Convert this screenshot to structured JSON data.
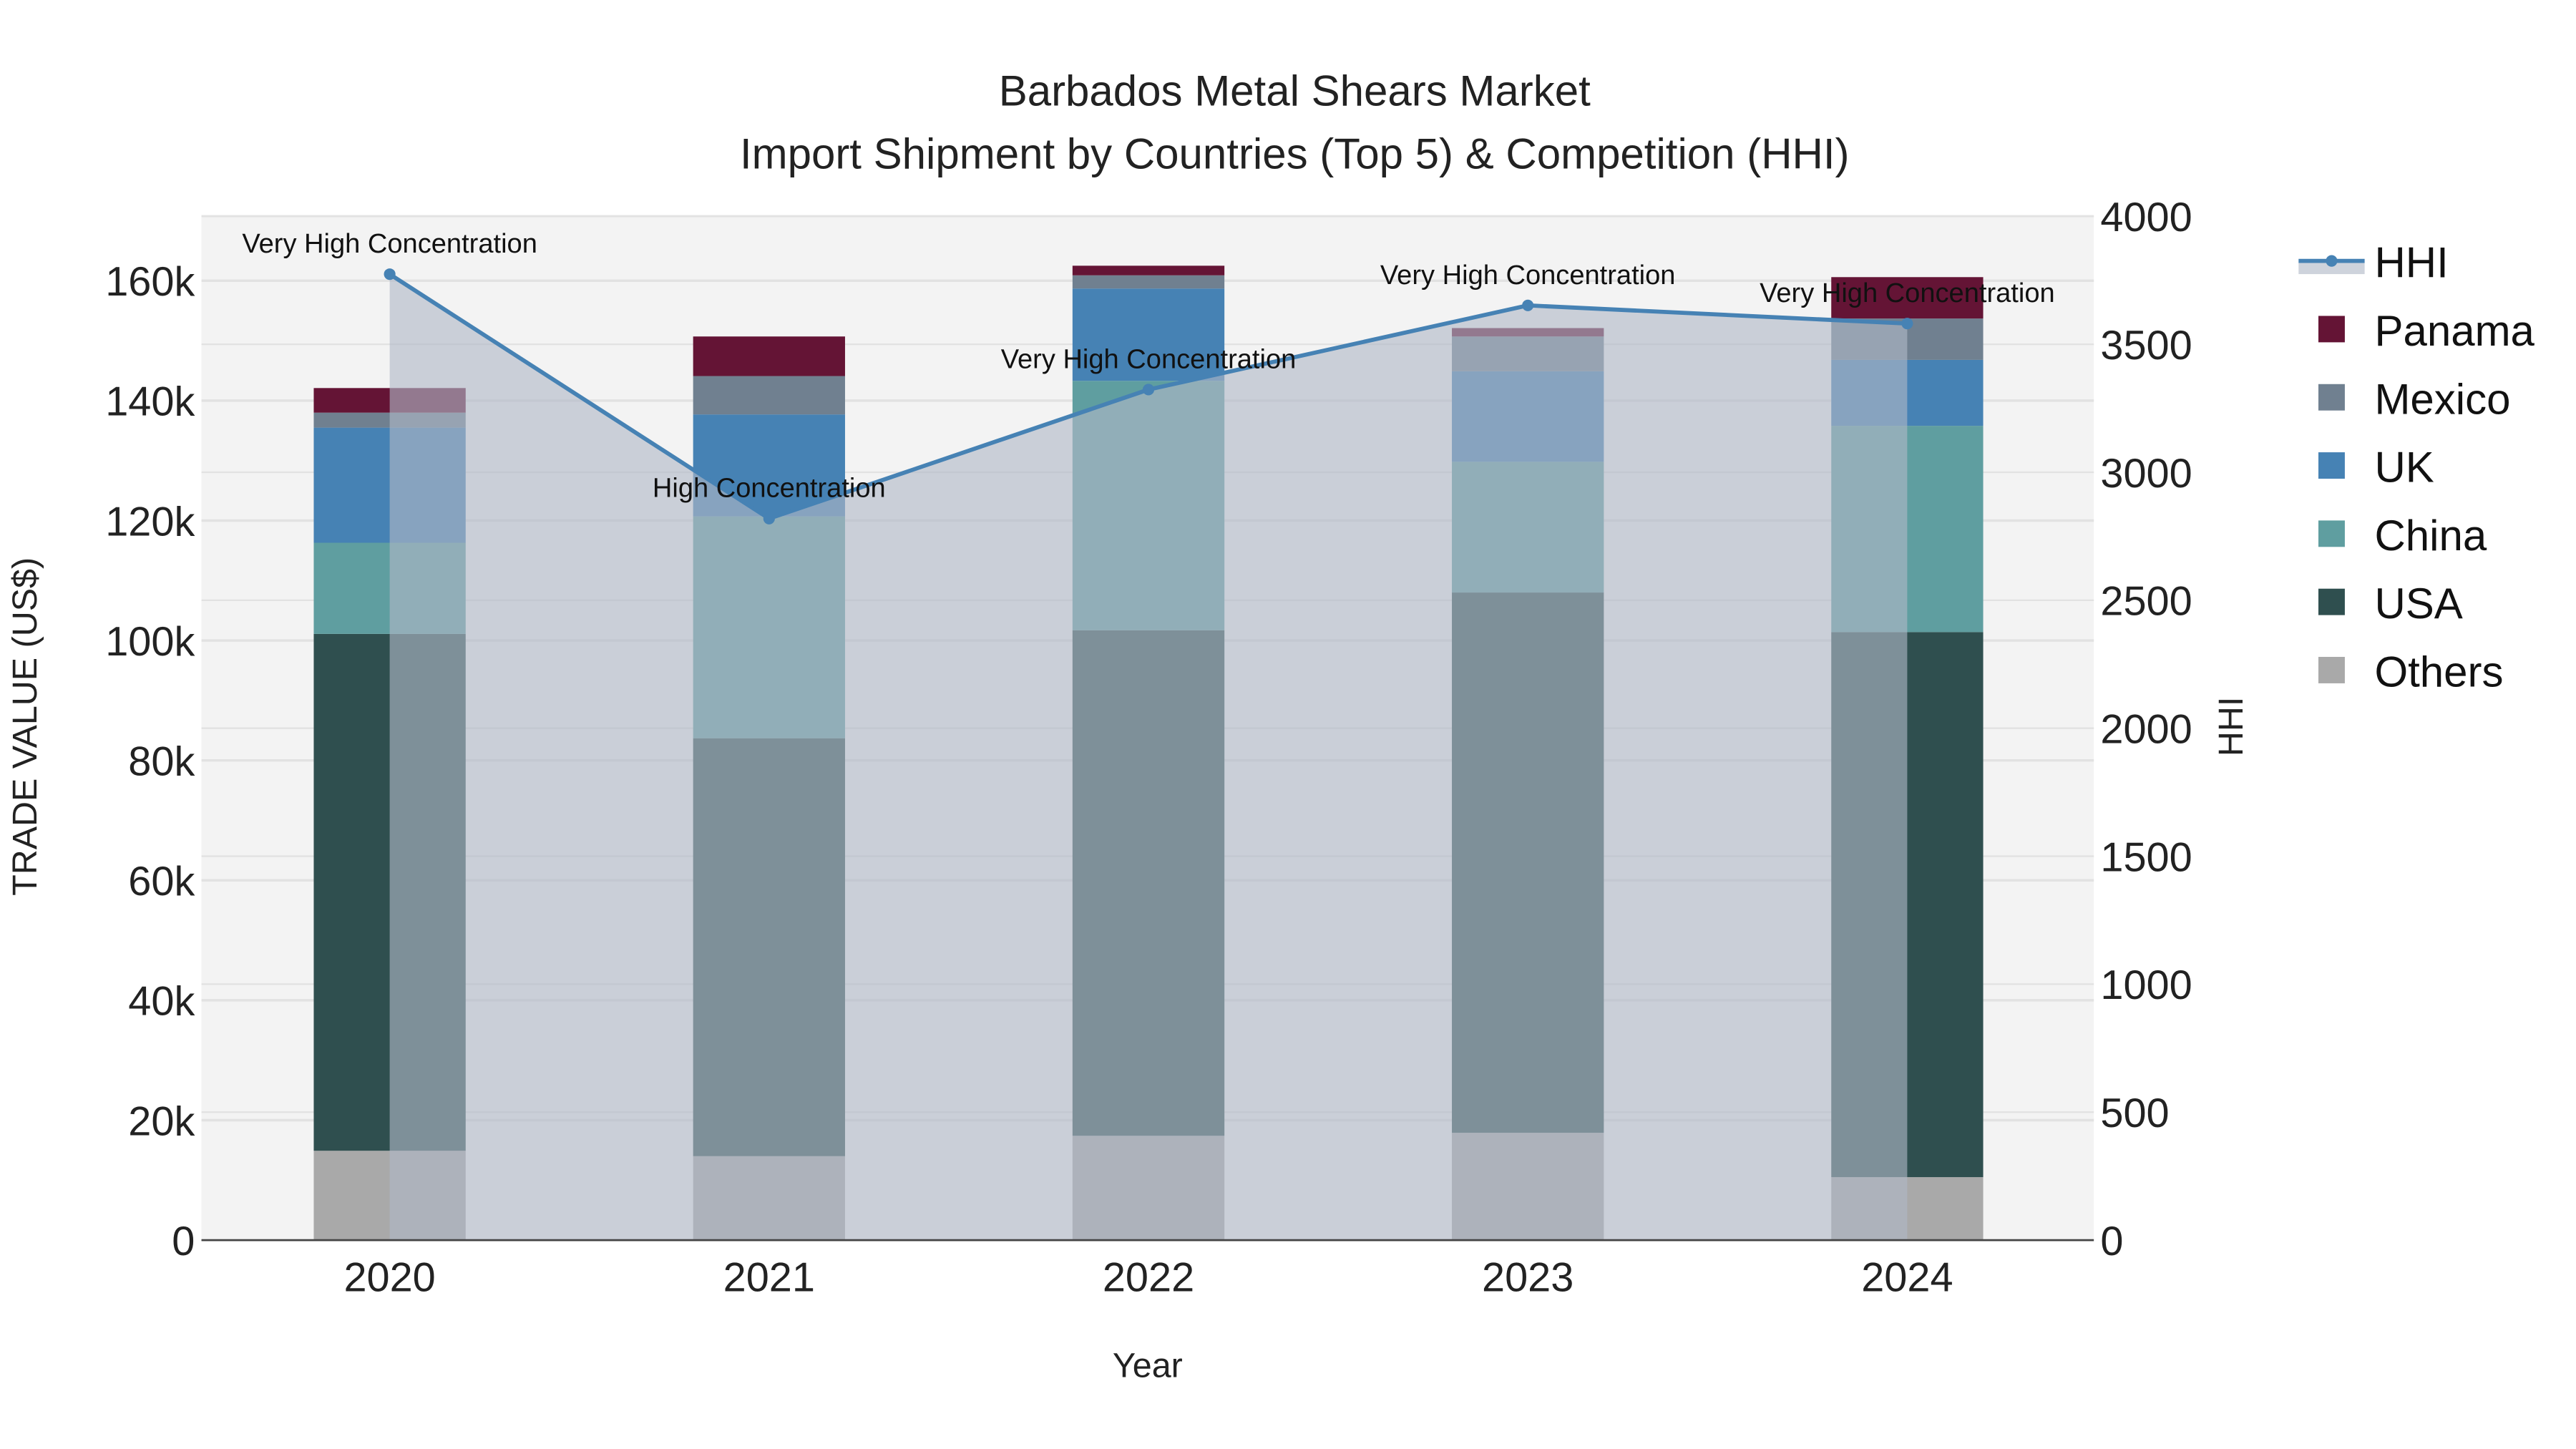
{
  "chart_data": {
    "type": "bar",
    "stacked": true,
    "title": "Barbados Metal Shears Market",
    "subtitle": "Import Shipment by Countries (Top 5) & Competition (HHI)",
    "xlabel": "Year",
    "ylabel": "TRADE VALUE (US$)",
    "y2label": "HHI",
    "categories": [
      "2020",
      "2021",
      "2022",
      "2023",
      "2024"
    ],
    "ylim": [
      0,
      170000
    ],
    "y_ticks": [
      0,
      20000,
      40000,
      60000,
      80000,
      100000,
      120000,
      140000,
      160000
    ],
    "y_tick_labels": [
      "0",
      "20k",
      "40k",
      "60k",
      "80k",
      "100k",
      "120k",
      "140k",
      "160k"
    ],
    "y2lim": [
      0,
      4000
    ],
    "y2_ticks": [
      0,
      500,
      1000,
      1500,
      2000,
      2500,
      3000,
      3500,
      4000
    ],
    "y2_tick_labels": [
      "0",
      "500",
      "1000",
      "1500",
      "2000",
      "2500",
      "3000",
      "3500",
      "4000"
    ],
    "grid": true,
    "legend_position": "right",
    "series": [
      {
        "name": "Others",
        "color": "#A9A9A9",
        "values": [
          14900,
          14000,
          17400,
          17900,
          10500
        ]
      },
      {
        "name": "USA",
        "color": "#2F4F4F",
        "values": [
          86200,
          69700,
          84300,
          90100,
          90900
        ]
      },
      {
        "name": "China",
        "color": "#5F9EA0",
        "values": [
          15200,
          37000,
          41600,
          21800,
          34400
        ]
      },
      {
        "name": "UK",
        "color": "#4682B4",
        "values": [
          19200,
          17000,
          15400,
          15100,
          11000
        ]
      },
      {
        "name": "Mexico",
        "color": "#708090",
        "values": [
          2500,
          6400,
          2200,
          5800,
          6900
        ]
      },
      {
        "name": "Panama",
        "color": "#641435",
        "values": [
          4100,
          6600,
          1600,
          1400,
          6900
        ]
      }
    ],
    "hhi": {
      "name": "HHI",
      "color": "#4682B4",
      "values": [
        3774,
        2819,
        3323,
        3652,
        3581
      ],
      "annotations": [
        "Very High Concentration",
        "High Concentration",
        "Very High Concentration",
        "Very High Concentration",
        "Very High Concentration"
      ]
    },
    "legend": [
      "HHI",
      "Panama",
      "Mexico",
      "UK",
      "China",
      "USA",
      "Others"
    ]
  }
}
